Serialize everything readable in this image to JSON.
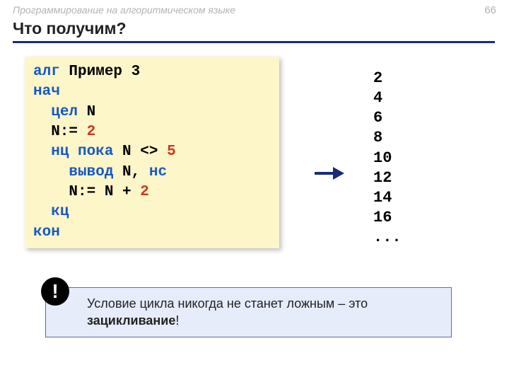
{
  "header": {
    "topic": "Программирование на алгоритмическом языке",
    "page_number": "66"
  },
  "title": "Что получим?",
  "code": {
    "l1a": "алг",
    "l1b": " Пример 3",
    "l2": "нач",
    "l3a": "  ",
    "l3b": "цел",
    "l3c": " N",
    "l4a": "  N:=",
    "l4b": " 2",
    "l5a": "  ",
    "l5b": "нц пока",
    "l5c": " N ",
    "l5d": "<>",
    "l5e": " 5",
    "l6a": "    ",
    "l6b": "вывод",
    "l6c": " N, ",
    "l6d": "нс",
    "l7a": "    N:= N +",
    "l7b": " 2",
    "l8a": "  ",
    "l8b": "кц",
    "l9": "кон"
  },
  "output_text": "2\n4\n6\n8\n10\n12\n14\n16\n...",
  "callout": {
    "bang": "!",
    "text_a": "Условие цикла никогда не станет ложным – это ",
    "text_b": "зацикливание",
    "text_c": "!"
  },
  "colors": {
    "rule": "#1b2a7a",
    "code_bg": "#fdf6c9",
    "keyword": "#1659c7",
    "number": "#cf351f",
    "callout_bg": "#e7ecfb"
  }
}
